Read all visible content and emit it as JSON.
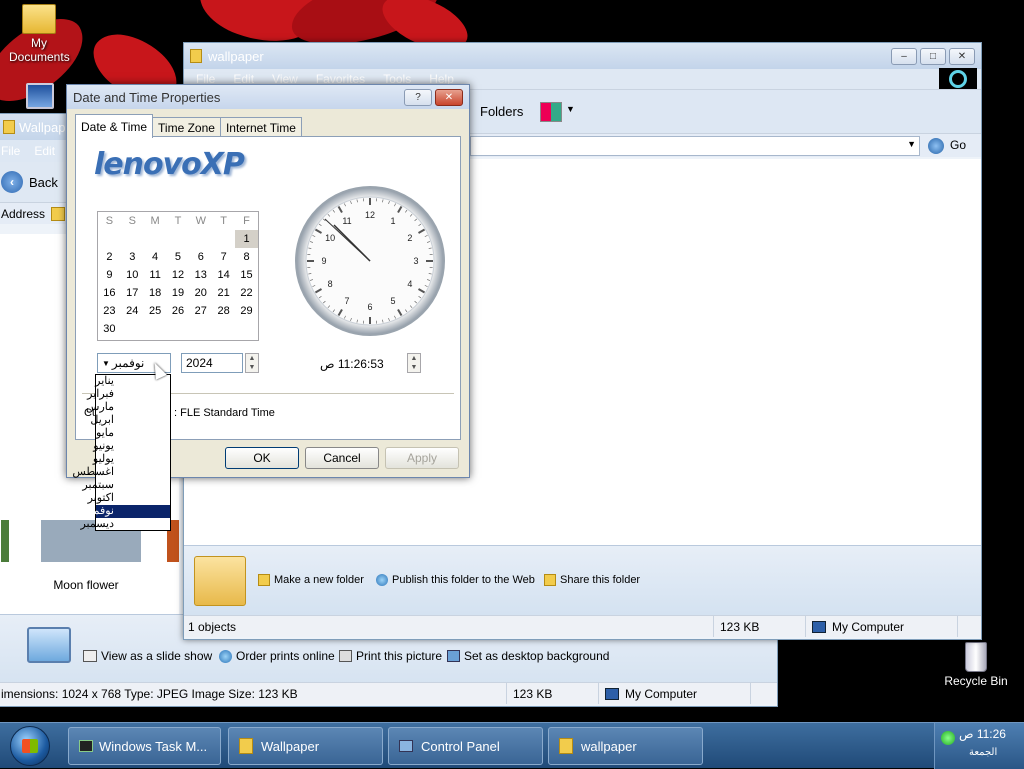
{
  "desktop": {
    "icons": [
      {
        "label": "My Documents"
      },
      {
        "label": "Recycle Bin"
      }
    ]
  },
  "back_window": {
    "title": "Wallpaper",
    "menu": [
      "File",
      "Edit"
    ],
    "back_label": "Back",
    "address_label": "Address",
    "thumb_label": "Moon flower",
    "tasks": [
      "View as a slide show",
      "Order prints online",
      "Print this picture",
      "Set as desktop background"
    ],
    "status": {
      "dimensions": "imensions: 1024 x 768 Type: JPEG Image Size: 123 KB",
      "size": "123 KB",
      "zone": "My Computer"
    }
  },
  "main_window": {
    "title": "wallpaper",
    "menu": [
      "File",
      "Edit",
      "View",
      "Favorites",
      "Tools",
      "Help"
    ],
    "folders_label": "Folders",
    "go_label": "Go",
    "tasks": [
      "Make a new folder",
      "Publish this folder to the Web",
      "Share this folder"
    ],
    "status": {
      "objects": "1 objects",
      "size": "123 KB",
      "zone": "My Computer"
    }
  },
  "dialog": {
    "title": "Date and Time Properties",
    "tabs": [
      "Date & Time",
      "Time Zone",
      "Internet Time"
    ],
    "logo": "lenovoXP",
    "weekdays": [
      "S",
      "S",
      "M",
      "T",
      "W",
      "T",
      "F"
    ],
    "weeks": [
      [
        "",
        "",
        "",
        "",
        "",
        "",
        "1"
      ],
      [
        "2",
        "3",
        "4",
        "5",
        "6",
        "7",
        "8"
      ],
      [
        "9",
        "10",
        "11",
        "12",
        "13",
        "14",
        "15"
      ],
      [
        "16",
        "17",
        "18",
        "19",
        "20",
        "21",
        "22"
      ],
      [
        "23",
        "24",
        "25",
        "26",
        "27",
        "28",
        "29"
      ],
      [
        "30",
        "",
        "",
        "",
        "",
        "",
        ""
      ]
    ],
    "selected_day": "1",
    "month_value": "نوفمبر",
    "year_value": "2024",
    "time_value": "11:26:53 ص",
    "timezone_prefix": "Cu",
    "timezone_value": ": FLE Standard Time",
    "months": [
      "يناير",
      "فبراير",
      "مارس",
      "ابريل",
      "مايو",
      "يونيو",
      "يوليو",
      "اغسطس",
      "سبتمبر",
      "اكتوبر",
      "نوفمبر",
      "ديسمبر"
    ],
    "selected_month_index": 10,
    "buttons": {
      "ok": "OK",
      "cancel": "Cancel",
      "apply": "Apply"
    },
    "clock_numbers": [
      "12",
      "1",
      "2",
      "3",
      "4",
      "5",
      "6",
      "7",
      "8",
      "9",
      "10",
      "11"
    ]
  },
  "taskbar": {
    "tasks": [
      "Windows Task M...",
      "Wallpaper",
      "Control Panel",
      "wallpaper"
    ],
    "clock_time": "11:26 ص",
    "clock_day": "الجمعة"
  }
}
